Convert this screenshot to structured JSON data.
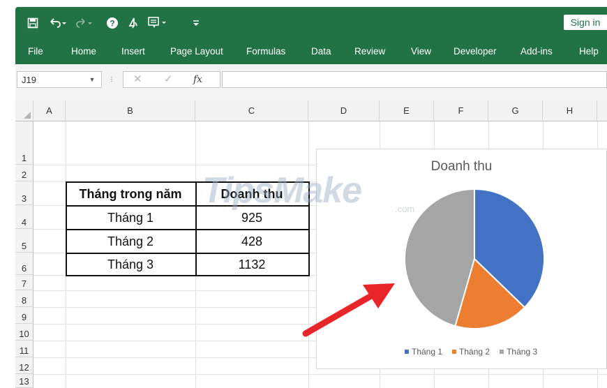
{
  "app": {
    "signin_label": "Sign in",
    "colors": {
      "ribbon": "#217346",
      "grid": "#e1e1e1"
    }
  },
  "quick_access": {
    "save_icon": "save-icon",
    "undo_icon": "undo-icon",
    "redo_icon": "redo-icon",
    "help_icon": "help-icon",
    "touch_icon": "touch-mode-icon",
    "form_icon": "form-icon",
    "customize_icon": "customize-qat-icon"
  },
  "menu": [
    "File",
    "Home",
    "Insert",
    "Page Layout",
    "Formulas",
    "Data",
    "Review",
    "View",
    "Developer",
    "Add-ins",
    "Help"
  ],
  "formula_bar": {
    "name_box": "J19",
    "formula": ""
  },
  "columns": [
    "A",
    "B",
    "C",
    "D",
    "E",
    "F",
    "G",
    "H"
  ],
  "rows": [
    "1",
    "2",
    "3",
    "4",
    "5",
    "6",
    "7",
    "8",
    "9",
    "10",
    "11",
    "12",
    "13"
  ],
  "table": {
    "header": [
      "Tháng trong năm",
      "Doanh thu"
    ],
    "rows": [
      [
        "Tháng 1",
        "925"
      ],
      [
        "Tháng 2",
        "428"
      ],
      [
        "Tháng 3",
        "1132"
      ]
    ]
  },
  "watermark": {
    "text": "TipsMake",
    "suffix": ".com"
  },
  "chart_data": {
    "type": "pie",
    "title": "Doanh thu",
    "categories": [
      "Tháng 1",
      "Tháng 2",
      "Tháng 3"
    ],
    "values": [
      925,
      428,
      1132
    ],
    "colors": [
      "#4472C4",
      "#ED7D31",
      "#A5A5A5"
    ],
    "legend_position": "bottom"
  }
}
